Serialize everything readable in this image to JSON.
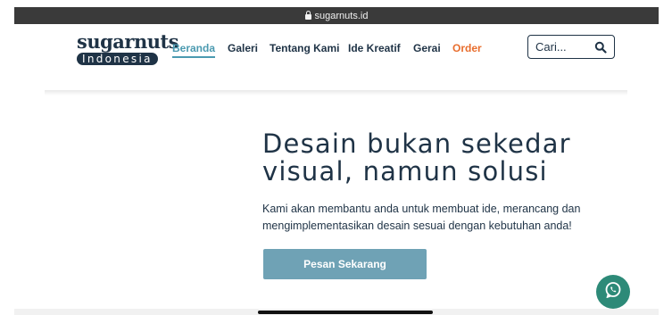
{
  "browser": {
    "url": "sugarnuts.id"
  },
  "logo": {
    "top": "sugarnuts",
    "bottom": "Indonesia"
  },
  "nav": {
    "items": [
      {
        "label": "Beranda",
        "active": true
      },
      {
        "label": "Galeri"
      },
      {
        "label": "Tentang Kami"
      },
      {
        "label": "Ide Kreatif"
      },
      {
        "label": "Gerai"
      },
      {
        "label": "Order"
      }
    ]
  },
  "search": {
    "placeholder": "Cari...",
    "icon": "search-icon"
  },
  "hero": {
    "title_lines": [
      "Desain bukan sekedar",
      "visual, namun solusi"
    ],
    "desc_lines": [
      "Kami akan membantu anda untuk membuat ide, merancang dan",
      "mengimplementasikan desain sesuai dengan kebutuhan anda!"
    ],
    "cta": "Pesan Sekarang"
  },
  "chat": {
    "icon": "whatsapp-icon",
    "color": "#2d8a78"
  },
  "colors": {
    "primary_text": "#1f3346",
    "active_nav": "#4b9ab0",
    "order_accent": "#e86d2d",
    "button_bg": "#6fa2b5"
  }
}
